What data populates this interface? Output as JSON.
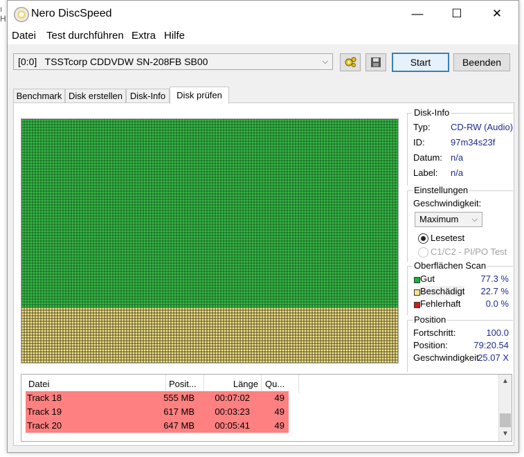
{
  "window": {
    "title": "Nero DiscSpeed"
  },
  "menu": [
    "Datei",
    "Test durchführen",
    "Extra",
    "Hilfe"
  ],
  "toolbar": {
    "drive": "[0:0]   TSSTcorp CDDVDW SN-208FB SB00",
    "start_label": "Start",
    "close_label": "Beenden",
    "icons": [
      "gear-icon",
      "save-icon"
    ]
  },
  "tabs": [
    "Benchmark",
    "Disk erstellen",
    "Disk-Info",
    "Disk prüfen"
  ],
  "active_tab": "Disk prüfen",
  "disk_info": {
    "title": "Disk-Info",
    "rows": [
      {
        "label": "Typ:",
        "value": "CD-RW (Audio)"
      },
      {
        "label": "ID:",
        "value": "97m34s23f"
      },
      {
        "label": "Datum:",
        "value": "n/a"
      },
      {
        "label": "Label:",
        "value": "n/a"
      }
    ]
  },
  "settings": {
    "title": "Einstellungen",
    "speed_label": "Geschwindigkeit:",
    "speed_value": "Maximum",
    "radio_read": "Lesetest",
    "radio_c1c2": "C1/C2 - PI/PO Test"
  },
  "surface_scan": {
    "title": "Oberflächen Scan",
    "items": [
      {
        "label": "Gut",
        "value": "77.3 %",
        "color": "#19b337"
      },
      {
        "label": "Beschädigt",
        "value": "22.7 %",
        "color": "#f0e58a"
      },
      {
        "label": "Fehlerhaft",
        "value": "0.0 %",
        "color": "#d21c1c"
      }
    ],
    "good_fraction": 0.773
  },
  "position": {
    "title": "Position",
    "rows": [
      {
        "label": "Fortschritt:",
        "value": "100.0"
      },
      {
        "label": "Position:",
        "value": "79:20.54"
      },
      {
        "label": "Geschwindigkeit",
        "value": "25.07 X"
      }
    ]
  },
  "table": {
    "columns": [
      "Datei",
      "Posit...",
      "Länge",
      "Qu..."
    ],
    "rows": [
      {
        "file": "Track 18",
        "pos": "555 MB",
        "len": "00:07:02",
        "q": "49"
      },
      {
        "file": "Track 19",
        "pos": "617 MB",
        "len": "00:03:23",
        "q": "49"
      },
      {
        "file": "Track 20",
        "pos": "647 MB",
        "len": "00:05:41",
        "q": "49"
      }
    ],
    "row_color": "#ff8080"
  }
}
